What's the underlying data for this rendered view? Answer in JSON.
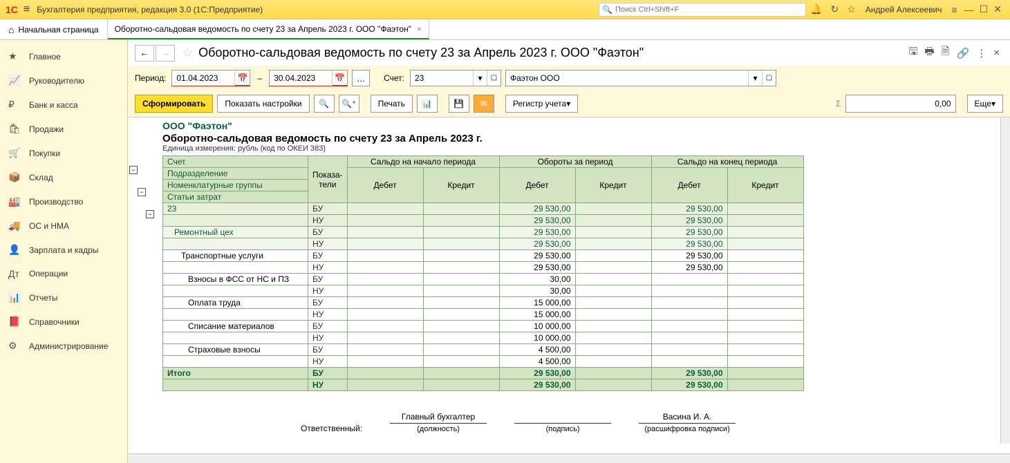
{
  "app": {
    "title": "Бухгалтерия предприятия, редакция 3.0  (1С:Предприятие)",
    "search_placeholder": "Поиск Ctrl+Shift+F",
    "user": "Андрей Алексеевич"
  },
  "tabs": {
    "home": "Начальная страница",
    "doc": "Оборотно-сальдовая ведомость по счету 23 за Апрель 2023 г. ООО \"Фаэтон\""
  },
  "sidebar": [
    {
      "icon": "★",
      "label": "Главное"
    },
    {
      "icon": "📈",
      "label": "Руководителю"
    },
    {
      "icon": "₽",
      "label": "Банк и касса"
    },
    {
      "icon": "🛍",
      "label": "Продажи"
    },
    {
      "icon": "🛒",
      "label": "Покупки"
    },
    {
      "icon": "📦",
      "label": "Склад"
    },
    {
      "icon": "🏭",
      "label": "Производство"
    },
    {
      "icon": "🚚",
      "label": "ОС и НМА"
    },
    {
      "icon": "👤",
      "label": "Зарплата и кадры"
    },
    {
      "icon": "Дт",
      "label": "Операции"
    },
    {
      "icon": "📊",
      "label": "Отчеты"
    },
    {
      "icon": "📕",
      "label": "Справочники"
    },
    {
      "icon": "⚙",
      "label": "Администрирование"
    }
  ],
  "header": {
    "title": "Оборотно-сальдовая ведомость по счету 23 за Апрель 2023 г. ООО \"Фаэтон\""
  },
  "params": {
    "period_label": "Период:",
    "date_from": "01.04.2023",
    "date_to": "30.04.2023",
    "ellipsis": "...",
    "account_label": "Счет:",
    "account": "23",
    "org": "Фаэтон ООО"
  },
  "toolbar": {
    "form": "Сформировать",
    "settings": "Показать настройки",
    "print": "Печать",
    "register": "Регистр учета",
    "sum": "0,00",
    "more": "Еще"
  },
  "report": {
    "company": "ООО \"Фаэтон\"",
    "title": "Оборотно-сальдовая ведомость по счету 23 за Апрель 2023 г.",
    "unit": "Единица измерения: рубль (код по ОКЕИ 383)",
    "headers": {
      "account": "Счет",
      "subdiv": "Подразделение",
      "nomgrp": "Номенклатурные группы",
      "cost": "Статьи затрат",
      "indicators": "Показа-\nтели",
      "opening": "Сальдо на начало периода",
      "turnover": "Обороты за период",
      "closing": "Сальдо на конец периода",
      "debit": "Дебет",
      "credit": "Кредит"
    },
    "rows": [
      {
        "level": 0,
        "name": "23",
        "ind": "БУ",
        "od": "29 530,00",
        "cd": "29 530,00"
      },
      {
        "level": 0,
        "name": "",
        "ind": "НУ",
        "od": "29 530,00",
        "cd": "29 530,00"
      },
      {
        "level": 1,
        "name": "Ремонтный цех",
        "ind": "БУ",
        "od": "29 530,00",
        "cd": "29 530,00"
      },
      {
        "level": 1,
        "name": "",
        "ind": "НУ",
        "od": "29 530,00",
        "cd": "29 530,00"
      },
      {
        "level": 2,
        "name": "Транспортные услуги",
        "ind": "БУ",
        "od": "29 530,00",
        "cd": "29 530,00"
      },
      {
        "level": 2,
        "name": "",
        "ind": "НУ",
        "od": "29 530,00",
        "cd": "29 530,00"
      },
      {
        "level": 3,
        "name": "Взносы в ФСС от НС и ПЗ",
        "ind": "БУ",
        "od": "30,00",
        "cd": ""
      },
      {
        "level": 3,
        "name": "",
        "ind": "НУ",
        "od": "30,00",
        "cd": ""
      },
      {
        "level": 3,
        "name": "Оплата труда",
        "ind": "БУ",
        "od": "15 000,00",
        "cd": ""
      },
      {
        "level": 3,
        "name": "",
        "ind": "НУ",
        "od": "15 000,00",
        "cd": ""
      },
      {
        "level": 3,
        "name": "Списание материалов",
        "ind": "БУ",
        "od": "10 000,00",
        "cd": ""
      },
      {
        "level": 3,
        "name": "",
        "ind": "НУ",
        "od": "10 000,00",
        "cd": ""
      },
      {
        "level": 3,
        "name": "Страховые взносы",
        "ind": "БУ",
        "od": "4 500,00",
        "cd": ""
      },
      {
        "level": 3,
        "name": "",
        "ind": "НУ",
        "od": "4 500,00",
        "cd": ""
      }
    ],
    "total_label": "Итого",
    "totals": [
      {
        "ind": "БУ",
        "od": "29 530,00",
        "cd": "29 530,00"
      },
      {
        "ind": "НУ",
        "od": "29 530,00",
        "cd": "29 530,00"
      }
    ],
    "sig": {
      "resp": "Ответственный:",
      "chief": "Главный бухгалтер",
      "position": "(должность)",
      "signature": "(подпись)",
      "name": "Васина И. А.",
      "decipher": "(расшифровка подписи)"
    }
  }
}
